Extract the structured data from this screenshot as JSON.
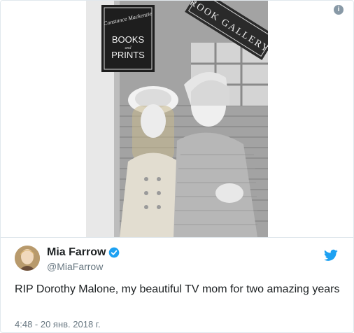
{
  "photo": {
    "sign_script": "Constance Mackenzie",
    "sign_line1": "BOOKS",
    "sign_and": "and",
    "sign_line2": "PRINTS",
    "gallery_sign": "ROOK GALLERY"
  },
  "author": {
    "display_name": "Mia Farrow",
    "handle": "@MiaFarrow"
  },
  "tweet": {
    "text": "RIP Dorothy Malone,  my beautiful TV mom for two amazing years",
    "timestamp": "4:48 - 20 янв. 2018 г."
  },
  "icons": {
    "info": "info-icon",
    "verified": "verified-badge-icon",
    "platform": "twitter-bird-icon"
  },
  "colors": {
    "accent": "#1da1f2",
    "text": "#1c2022",
    "secondary": "#697882",
    "border": "#e1e8ed"
  }
}
